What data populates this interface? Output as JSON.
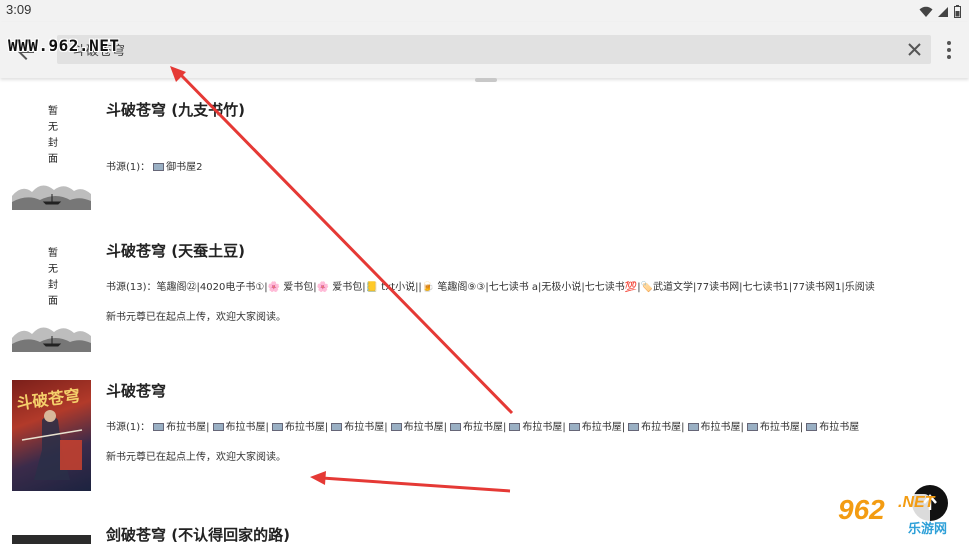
{
  "status_bar": {
    "time": "3:09"
  },
  "toolbar": {
    "search_value": "斗破苍穹",
    "watermark": "WWW.962.NET"
  },
  "results": [
    {
      "title": "斗破苍穹 (九支书竹)",
      "cover_placeholder": [
        "暂",
        "无",
        "封",
        "面"
      ],
      "sources": "书源(1)：",
      "source_names": "御书屋2",
      "intro": ""
    },
    {
      "title": "斗破苍穹 (天蚕土豆)",
      "cover_placeholder": [
        "暂",
        "无",
        "封",
        "面"
      ],
      "sources": "书源(13)：笔趣阁㉒|4020电子书①|🌸 爱书包|🌸 爱书包|📒 txt小说||🍺 笔趣阁⑨③|七七读书 a|无极小说|七七读书💯|🏷️武道文学|77读书网|七七读书1|77读书网1|乐阅读",
      "intro": "新书元尊已在起点上传，欢迎大家阅读。"
    },
    {
      "title": "斗破苍穹",
      "cover_text": "斗破苍穹",
      "sources_prefix": "书源(1)：",
      "source_items": [
        "布拉书屋",
        "布拉书屋",
        "布拉书屋",
        "布拉书屋",
        "布拉书屋",
        "布拉书屋",
        "布拉书屋",
        "布拉书屋",
        "布拉书屋",
        "布拉书屋",
        "布拉书屋",
        "布拉书屋"
      ],
      "intro": "新书元尊已在起点上传，欢迎大家阅读。"
    },
    {
      "title": "剑破苍穹 (不认得回家的路)"
    }
  ],
  "logo": {
    "brand": "962",
    "suffix": ".NET",
    "caption": "乐游网"
  },
  "colors": {
    "toolbar": "#f2f2f2",
    "search_bg": "#e1e1e1",
    "arrow": "#e53935",
    "logo_orange": "#f39c12"
  }
}
